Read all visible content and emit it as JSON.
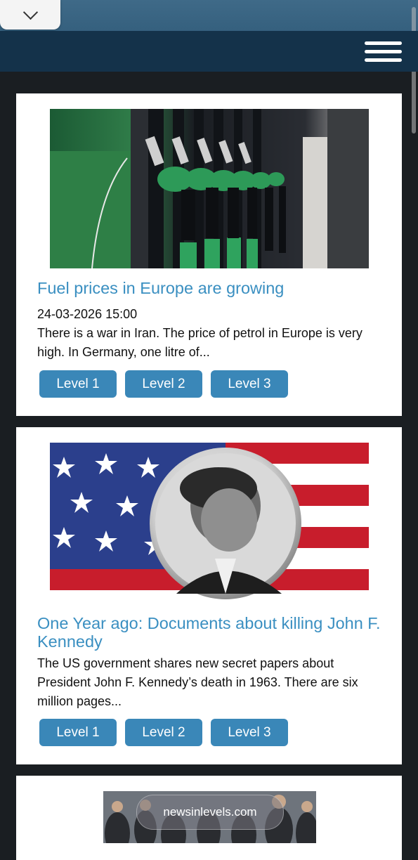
{
  "menu": {
    "collapse_icon": "chevron-down-icon",
    "hamburger_icon": "hamburger-menu-icon"
  },
  "articles": [
    {
      "title": "Fuel prices in Europe are growing",
      "date": "24-03-2026 15:00",
      "summary": "There is a war in Iran. The price of petrol in Europe is very high. In Germany, one litre of...",
      "levels": [
        "Level 1",
        "Level 2",
        "Level 3"
      ]
    },
    {
      "title": "One Year ago: Documents about killing John F. Kennedy",
      "summary": "The US government shares new secret papers about President John F. Kennedy’s death in 1963. There are six million pages...",
      "levels": [
        "Level 1",
        "Level 2",
        "Level 3"
      ]
    },
    {
      "badge": "newsinlevels.com"
    }
  ],
  "colors": {
    "header": "#14324a",
    "accent": "#3a8fc1",
    "button": "#3a87b8"
  }
}
